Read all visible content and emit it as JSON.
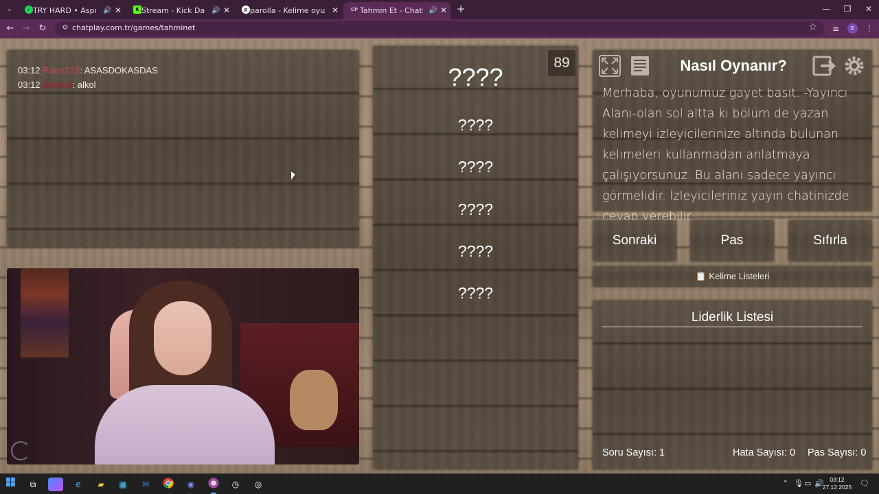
{
  "browser": {
    "tabs": [
      {
        "title": "TRY HARD • Aspova, Ceg",
        "favicon": "spotify-icon"
      },
      {
        "title": "Stream - Kick Dashboard",
        "favicon": "kick-icon"
      },
      {
        "title": "parolla - Kelime oyunu. Günlük",
        "favicon": "parolla-icon"
      },
      {
        "title": "Tahmin Et - ChatPlay",
        "favicon": "chatplay-icon",
        "active": true
      }
    ],
    "url": "chatplay.com.tr/games/tahminet",
    "profile_initial": "E"
  },
  "chat": {
    "messages": [
      {
        "time": "03:12",
        "user": "Rarer123",
        "text": ": ASASDOKASDAS"
      },
      {
        "time": "03:12",
        "user": "pmmud",
        "text": ": alkol"
      }
    ]
  },
  "game": {
    "timer": "89",
    "main_word": "????",
    "taboo_words": [
      "????",
      "????",
      "????",
      "????",
      "????"
    ]
  },
  "howto": {
    "title": "Nasıl Oynanır?",
    "text": "Merhaba, oyunumuz gayet basit. -Yayıncı Alanı-olan sol altta ki bölüm de yazan kelimeyi izleyicilerinize altında bulunan kelimeleri kullanmadan anlatmaya çalışıyorsunuz. Bu alanı sadece yayıncı görmelidir. İzleyicileriniz yayın chatinizde cevap verebilir."
  },
  "controls": {
    "next": "Sonraki",
    "pass": "Pas",
    "reset": "Sıfırla",
    "word_lists": "Kelime Listeleri"
  },
  "leaderboard": {
    "title": "Liderlik Listesi",
    "question_count": "Soru Sayısı: 1",
    "error_count": "Hata Sayısı: 0",
    "pass_count": "Pas Sayısı: 0"
  },
  "taskbar": {
    "time": "03:12",
    "date": "27.12.2025"
  }
}
